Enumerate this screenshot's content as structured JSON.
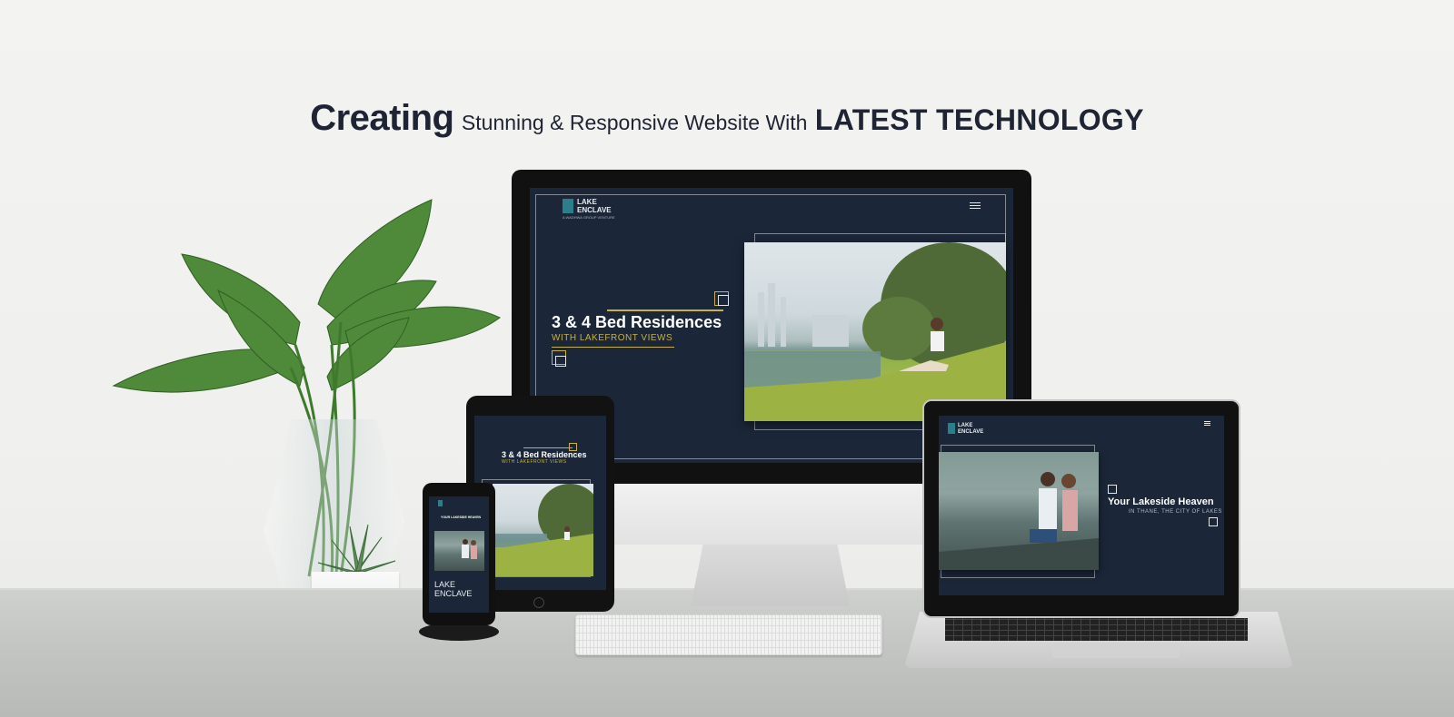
{
  "headline": {
    "part1": "Creating",
    "part2": "Stunning & Responsive Website With",
    "part3": "LATEST TECHNOLOGY"
  },
  "brand": {
    "line1": "LAKE",
    "line2": "ENCLAVE",
    "tagline": "A WADHWA GROUP VENTURE"
  },
  "desktop_site": {
    "title": "3 & 4 Bed Residences",
    "subtitle": "WITH LAKEFRONT VIEWS"
  },
  "tablet_site": {
    "title": "3 & 4 Bed Residences",
    "subtitle": "WITH LAKEFRONT VIEWS"
  },
  "phone_site": {
    "top_text": "YOUR LAKESIDE HEAVEN",
    "logo_line1": "LAKE",
    "logo_line2": "ENCLAVE"
  },
  "laptop_site": {
    "title": "Your Lakeside Heaven",
    "subtitle": "IN THANE, THE CITY OF LAKES"
  },
  "colors": {
    "site_background": "#1b2638",
    "accent_gold": "#c7b04a",
    "logo_teal": "#2c7f8a",
    "headline": "#1e2433"
  }
}
